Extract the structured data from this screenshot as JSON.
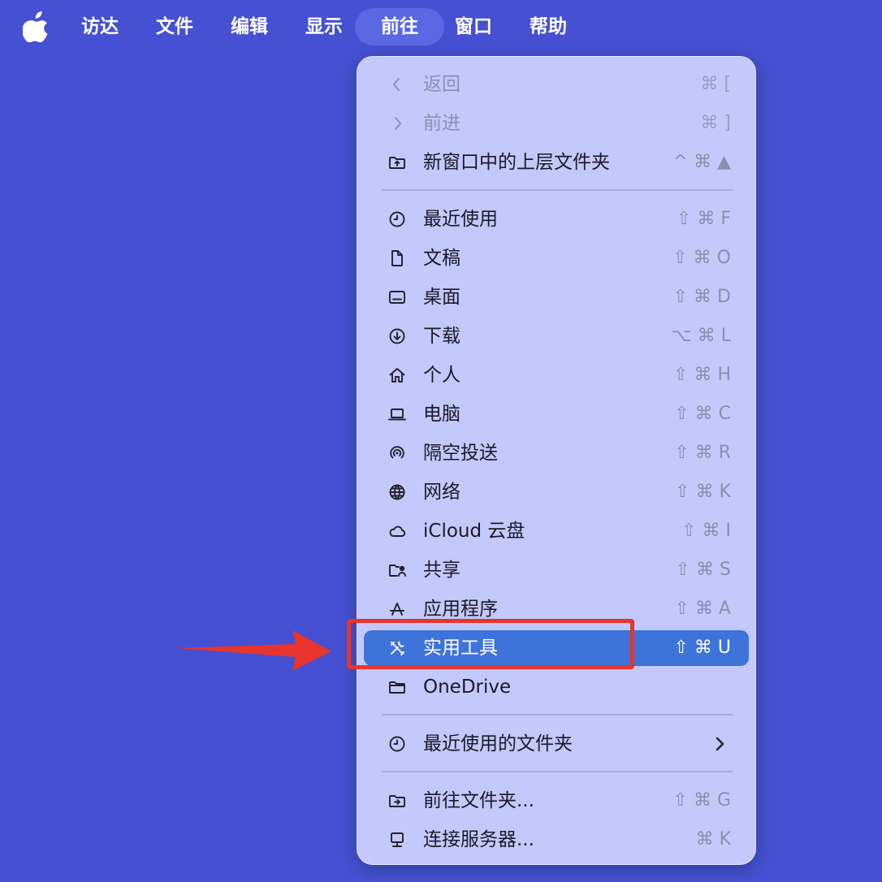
{
  "menubar": {
    "apple_icon": "apple-logo-icon",
    "items": [
      {
        "label": "访达"
      },
      {
        "label": "文件"
      },
      {
        "label": "编辑"
      },
      {
        "label": "显示"
      },
      {
        "label": "前往",
        "active": true
      },
      {
        "label": "窗口"
      },
      {
        "label": "帮助"
      }
    ]
  },
  "menu": {
    "items": [
      {
        "label": "返回",
        "shortcut": "⌘ [",
        "icon": "chevron-left-icon",
        "disabled": true
      },
      {
        "label": "前进",
        "shortcut": "⌘ ]",
        "icon": "chevron-right-icon",
        "disabled": true
      },
      {
        "label": "新窗口中的上层文件夹",
        "shortcut": "^ ⌘ ▲",
        "icon": "folder-up-icon"
      },
      {
        "label": "最近使用",
        "shortcut": "⇧ ⌘ F",
        "icon": "clock-icon"
      },
      {
        "label": "文稿",
        "shortcut": "⇧ ⌘ O",
        "icon": "document-icon"
      },
      {
        "label": "桌面",
        "shortcut": "⇧ ⌘ D",
        "icon": "desktop-icon"
      },
      {
        "label": "下载",
        "shortcut": "⌥ ⌘ L",
        "icon": "download-icon"
      },
      {
        "label": "个人",
        "shortcut": "⇧ ⌘ H",
        "icon": "home-icon"
      },
      {
        "label": "电脑",
        "shortcut": "⇧ ⌘ C",
        "icon": "laptop-icon"
      },
      {
        "label": "隔空投送",
        "shortcut": "⇧ ⌘ R",
        "icon": "airdrop-icon"
      },
      {
        "label": "网络",
        "shortcut": "⇧ ⌘ K",
        "icon": "globe-icon"
      },
      {
        "label": "iCloud 云盘",
        "shortcut": "⇧ ⌘ I",
        "icon": "cloud-icon"
      },
      {
        "label": "共享",
        "shortcut": "⇧ ⌘ S",
        "icon": "shared-folder-icon"
      },
      {
        "label": "应用程序",
        "shortcut": "⇧ ⌘ A",
        "icon": "applications-icon"
      },
      {
        "label": "实用工具",
        "shortcut": "⇧ ⌘ U",
        "icon": "tools-icon",
        "selected": true
      },
      {
        "label": "OneDrive",
        "shortcut": "",
        "icon": "folder-icon"
      },
      {
        "label": "最近使用的文件夹",
        "shortcut": "",
        "icon": "clock-icon",
        "submenu": true
      },
      {
        "label": "前往文件夹...",
        "shortcut": "⇧ ⌘ G",
        "icon": "go-folder-icon"
      },
      {
        "label": "连接服务器...",
        "shortcut": "⌘ K",
        "icon": "server-icon"
      }
    ]
  },
  "colors": {
    "background": "#4450cf",
    "menu_background": "#c3c9fa",
    "selection": "#3e73da",
    "annotation": "#e7342c"
  }
}
